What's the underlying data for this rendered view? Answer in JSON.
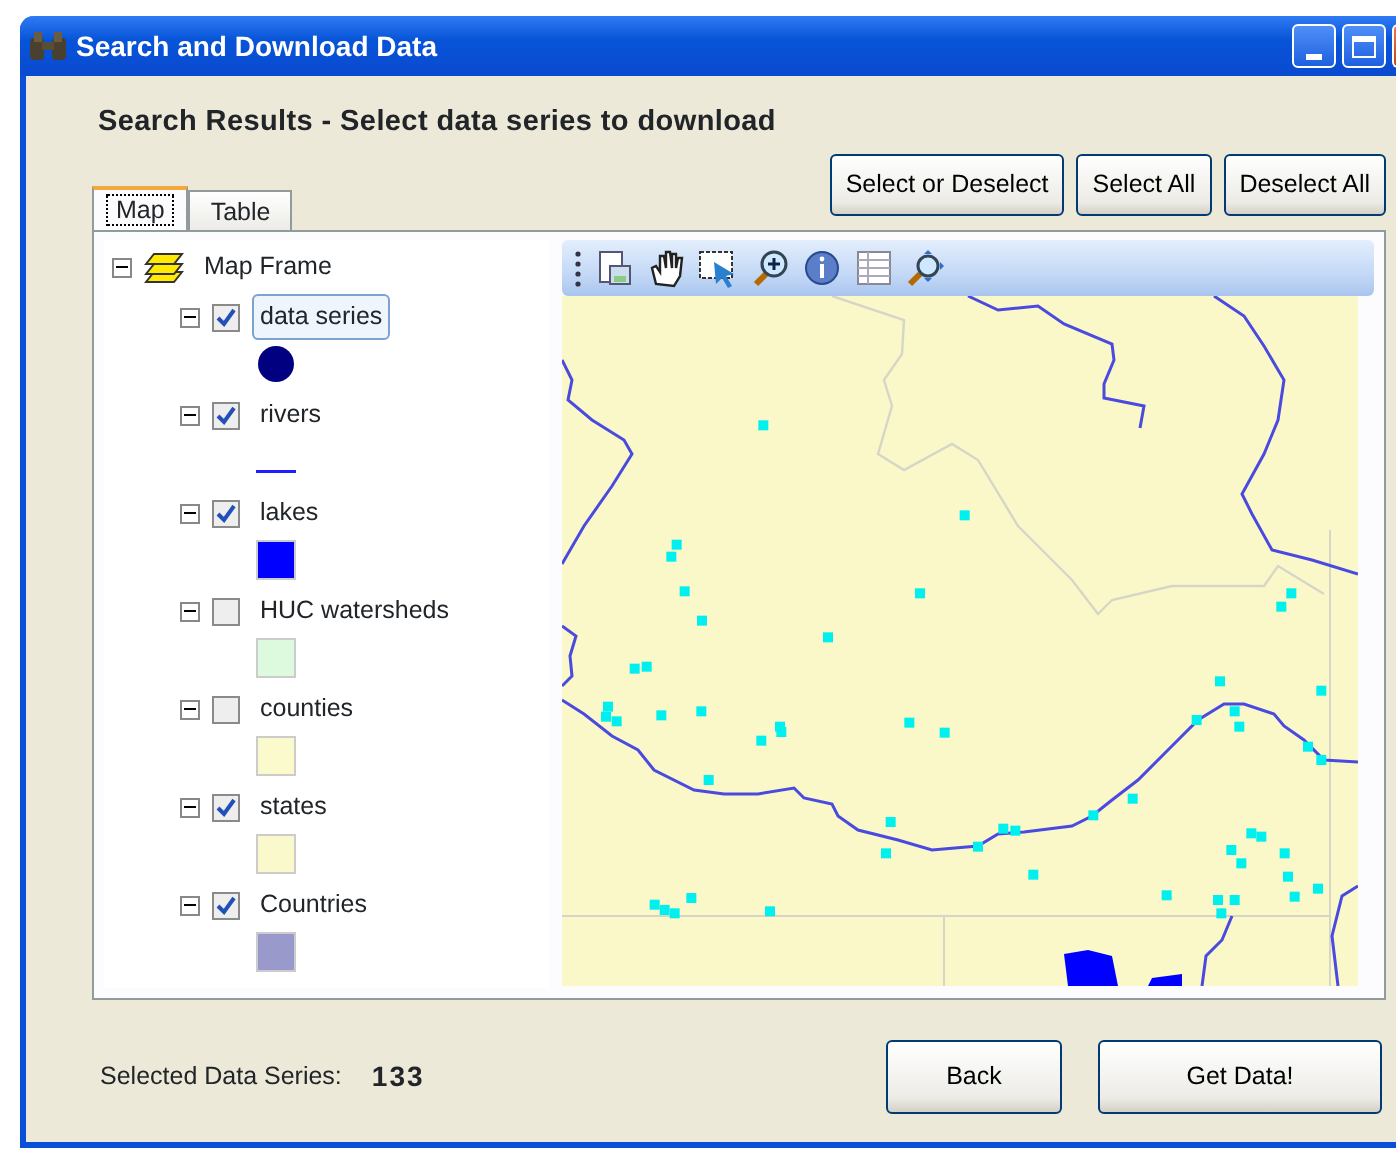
{
  "window": {
    "title": "Search and Download Data"
  },
  "heading": "Search Results - Select data series to download",
  "tabs": [
    {
      "label": "Map",
      "selected": true
    },
    {
      "label": "Table",
      "selected": false
    }
  ],
  "actions": [
    "Select or Deselect",
    "Select All",
    "Deselect All"
  ],
  "legend": {
    "root": {
      "label": "Map Frame",
      "expanded": true
    },
    "layers": [
      {
        "label": "data series",
        "checked": true,
        "selected": true,
        "expanded": true,
        "kind": "circle",
        "color": "#000080"
      },
      {
        "label": "rivers",
        "checked": true,
        "selected": false,
        "expanded": true,
        "kind": "line",
        "color": "#2020ff"
      },
      {
        "label": "lakes",
        "checked": true,
        "selected": false,
        "expanded": true,
        "kind": "square",
        "color": "#0000ff"
      },
      {
        "label": "HUC watersheds",
        "checked": false,
        "selected": false,
        "expanded": true,
        "kind": "square",
        "color": "#ddfade"
      },
      {
        "label": "counties",
        "checked": false,
        "selected": false,
        "expanded": true,
        "kind": "square",
        "color": "#fafacc"
      },
      {
        "label": "states",
        "checked": true,
        "selected": false,
        "expanded": true,
        "kind": "square",
        "color": "#faf9cb"
      },
      {
        "label": "Countries",
        "checked": true,
        "selected": false,
        "expanded": true,
        "kind": "square",
        "color": "#9999cc"
      }
    ]
  },
  "status": {
    "label": "Selected Data Series:",
    "count": "133"
  },
  "buttons": [
    "Back",
    "Get Data!"
  ]
}
